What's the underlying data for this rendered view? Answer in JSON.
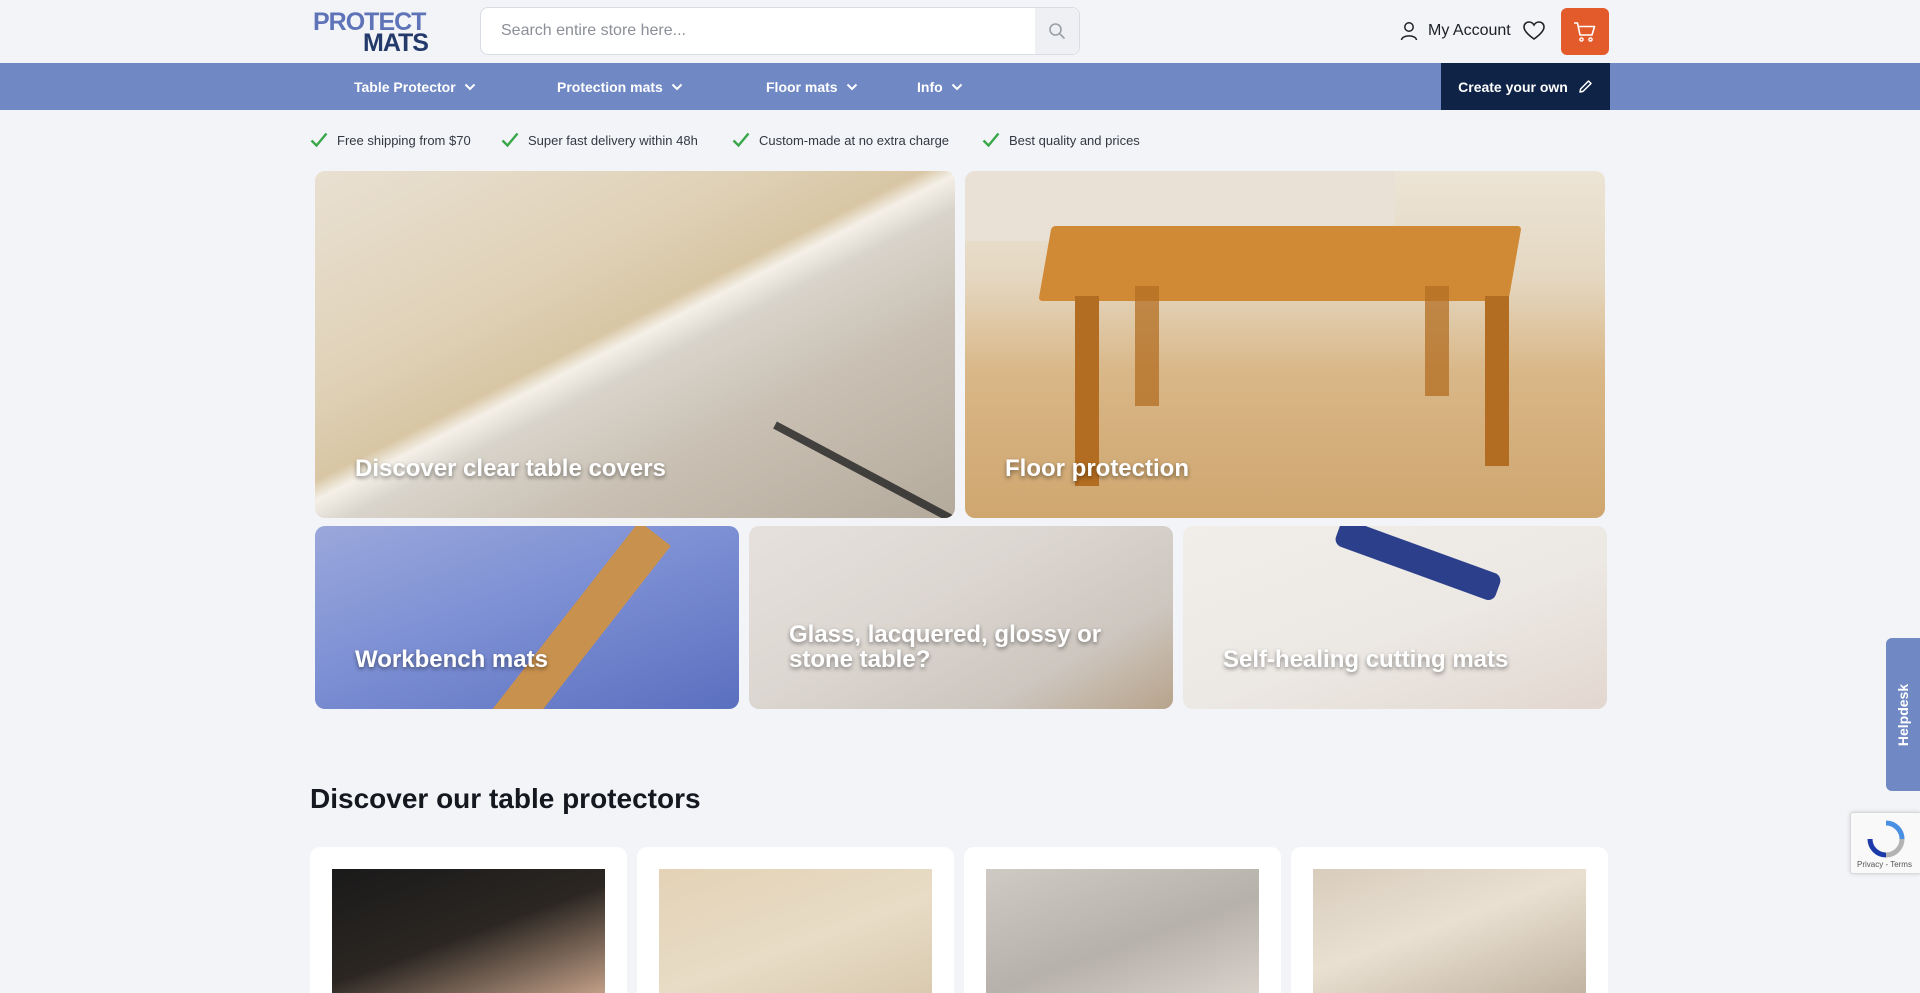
{
  "header": {
    "logo_line1": "PROTECT",
    "logo_line2": "MATS",
    "search_placeholder": "Search entire store here...",
    "account_label": "My Account"
  },
  "nav": {
    "items": [
      {
        "label": "Table Protector"
      },
      {
        "label": "Protection mats"
      },
      {
        "label": "Floor mats"
      },
      {
        "label": "Info"
      }
    ],
    "create_label": "Create your own"
  },
  "usps": [
    "Free shipping from $70",
    "Super fast delivery within 48h",
    "Custom-made at no extra charge",
    "Best quality and prices"
  ],
  "tiles": [
    {
      "caption": "Discover clear table covers"
    },
    {
      "caption": "Floor protection"
    },
    {
      "caption": "Workbench mats"
    },
    {
      "caption": "Glass, lacquered, glossy or stone table?"
    },
    {
      "caption": "Self-healing cutting mats"
    }
  ],
  "section": {
    "title": "Discover our table protectors"
  },
  "helpdesk_label": "Helpdesk",
  "recaptcha_text": "Privacy - Terms",
  "colors": {
    "nav": "#7088c4",
    "create": "#0f2347",
    "cart": "#e35a2b",
    "check": "#3aa64a"
  }
}
